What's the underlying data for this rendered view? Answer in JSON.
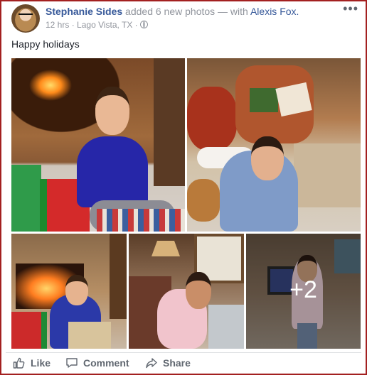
{
  "post": {
    "author": "Stephanie Sides",
    "action": "added 6 new photos — with",
    "tagged": "Alexis Fox.",
    "time": "12 hrs",
    "separator": "·",
    "location": "Lago Vista, TX",
    "menu_icon": "more-dots-icon",
    "privacy_icon": "globe-icon",
    "message": "Happy holidays"
  },
  "photos": {
    "extra_count": "+2"
  },
  "actions": {
    "like": "Like",
    "comment": "Comment",
    "share": "Share"
  },
  "colors": {
    "frame_border": "#a32020",
    "link": "#365899",
    "meta_text": "#90949c",
    "action_text": "#606770"
  }
}
